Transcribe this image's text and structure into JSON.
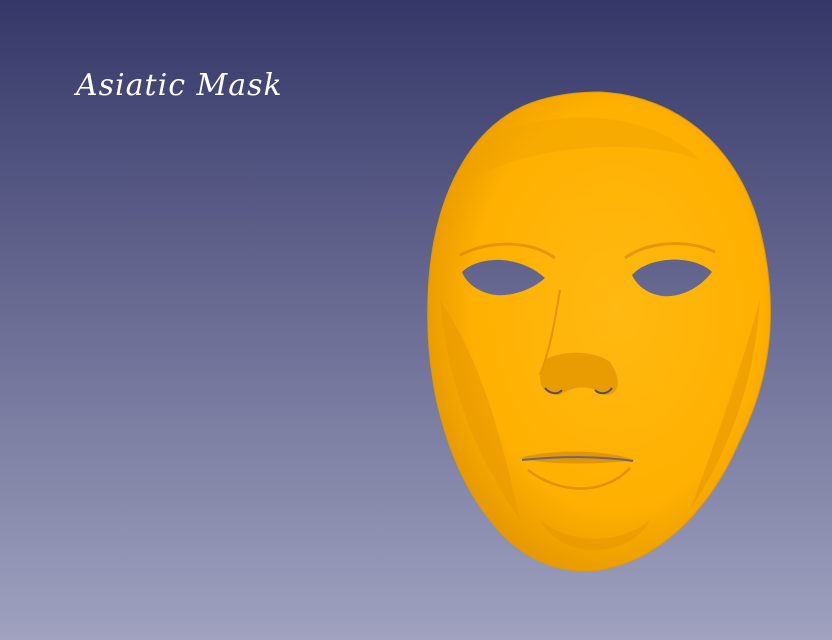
{
  "scene": {
    "title": "Asiatic Mask",
    "background_top_color": "#353868",
    "background_bottom_color": "#a0a2c0",
    "mask_color": "#ffb000",
    "mask_shadow_color": "#d98c00",
    "eye_hole_color": "background"
  }
}
